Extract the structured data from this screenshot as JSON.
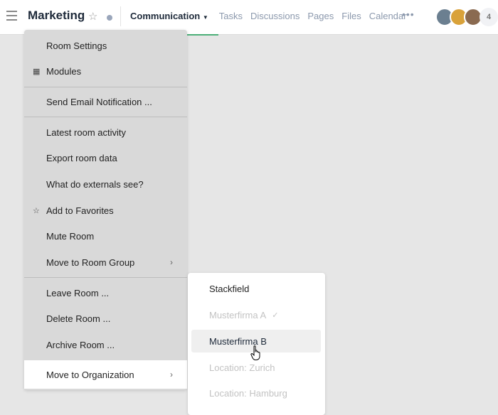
{
  "header": {
    "title": "Marketing",
    "tabs": [
      {
        "label": "Communication",
        "active": true
      },
      {
        "label": "Tasks"
      },
      {
        "label": "Discussions"
      },
      {
        "label": "Pages"
      },
      {
        "label": "Files"
      },
      {
        "label": "Calendar"
      }
    ],
    "more": "•••",
    "member_count": "4",
    "accent": "#4caf78"
  },
  "menu": {
    "items": [
      {
        "label": "Room Settings"
      },
      {
        "label": "Modules",
        "icon": "grid-icon"
      },
      {
        "label": "Send Email Notification ..."
      },
      {
        "label": "Latest room activity"
      },
      {
        "label": "Export room data"
      },
      {
        "label": "What do externals see?"
      },
      {
        "label": "Add to Favorites",
        "icon": "star-icon"
      },
      {
        "label": "Mute Room"
      },
      {
        "label": "Move to Room Group",
        "submenu": true
      },
      {
        "label": "Leave Room ..."
      },
      {
        "label": "Delete Room ..."
      },
      {
        "label": "Archive Room ..."
      },
      {
        "label": "Move to Organization",
        "submenu": true,
        "highlighted": true
      }
    ]
  },
  "submenu": {
    "items": [
      {
        "label": "Stackfield"
      },
      {
        "label": "Musterfirma A",
        "disabled": true,
        "checked": true
      },
      {
        "label": "Musterfirma B",
        "hovered": true
      },
      {
        "label": "Location: Zurich",
        "disabled": true
      },
      {
        "label": "Location: Hamburg",
        "disabled": true
      }
    ]
  }
}
